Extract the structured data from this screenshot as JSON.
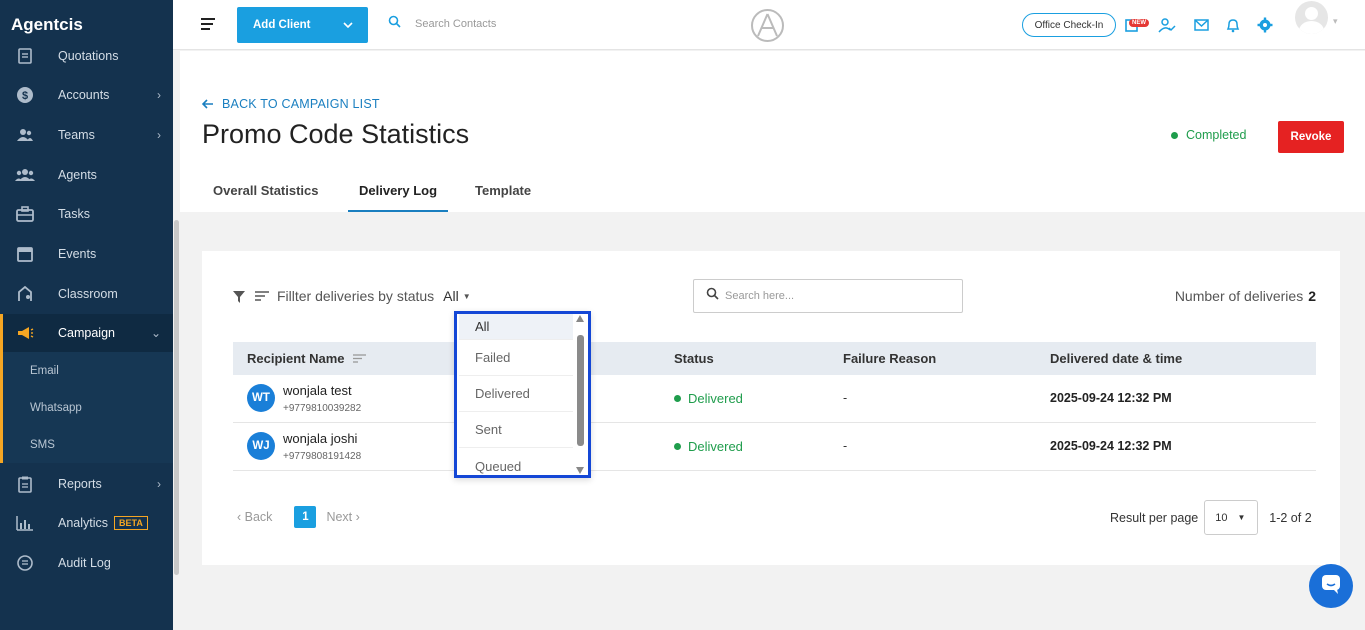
{
  "sidebar": {
    "brand": "Agentcis",
    "items": [
      {
        "label": "Quotations",
        "icon": "document-icon"
      },
      {
        "label": "Accounts",
        "icon": "dollar-icon"
      },
      {
        "label": "Teams",
        "icon": "team-icon"
      },
      {
        "label": "Agents",
        "icon": "agents-icon"
      },
      {
        "label": "Tasks",
        "icon": "briefcase-icon"
      },
      {
        "label": "Events",
        "icon": "calendar-icon"
      },
      {
        "label": "Classroom",
        "icon": "classroom-icon"
      },
      {
        "label": "Campaign",
        "icon": "megaphone-icon"
      },
      {
        "label": "Reports",
        "icon": "clipboard-icon"
      },
      {
        "label": "Analytics",
        "icon": "chart-icon",
        "badge": "BETA"
      },
      {
        "label": "Audit Log",
        "icon": "audit-icon"
      }
    ],
    "sub_items": [
      "Email",
      "Whatsapp",
      "SMS"
    ]
  },
  "topbar": {
    "add_client": "Add Client",
    "search_placeholder": "Search Contacts",
    "checkin": "Office Check-In",
    "new_badge": "NEW"
  },
  "header": {
    "back": "BACK TO CAMPAIGN LIST",
    "title": "Promo Code Statistics",
    "status": "Completed",
    "revoke": "Revoke",
    "tabs": [
      "Overall Statistics",
      "Delivery Log",
      "Template"
    ]
  },
  "filter": {
    "label": "Fillter deliveries by status",
    "selected": "All",
    "search_placeholder": "Search here...",
    "count_label": "Number of deliveries",
    "count": "2"
  },
  "table": {
    "columns": [
      "Recipient Name",
      "Status",
      "Failure Reason",
      "Delivered date & time"
    ],
    "rows": [
      {
        "initials": "WT",
        "name": "wonjala test",
        "phone": "+9779810039282",
        "status": "Delivered",
        "reason": "-",
        "date": "2025-09-24 12:32 PM"
      },
      {
        "initials": "WJ",
        "name": "wonjala joshi",
        "phone": "+9779808191428",
        "status": "Delivered",
        "reason": "-",
        "date": "2025-09-24 12:32 PM"
      }
    ]
  },
  "pagination": {
    "back": "Back",
    "page": "1",
    "next": "Next",
    "per_page_label": "Result per page",
    "per_page": "10",
    "range": "1-2 of 2"
  },
  "dropdown": {
    "options": [
      "All",
      "Failed",
      "Delivered",
      "Sent",
      "Queued"
    ]
  },
  "colors": {
    "sidebar_bg": "#14324e",
    "accent_blue": "#1a9fe0",
    "active_orange": "#f5a623",
    "success_green": "#1f9d4c",
    "revoke_red": "#e52222",
    "highlight_border": "#1447d6"
  }
}
